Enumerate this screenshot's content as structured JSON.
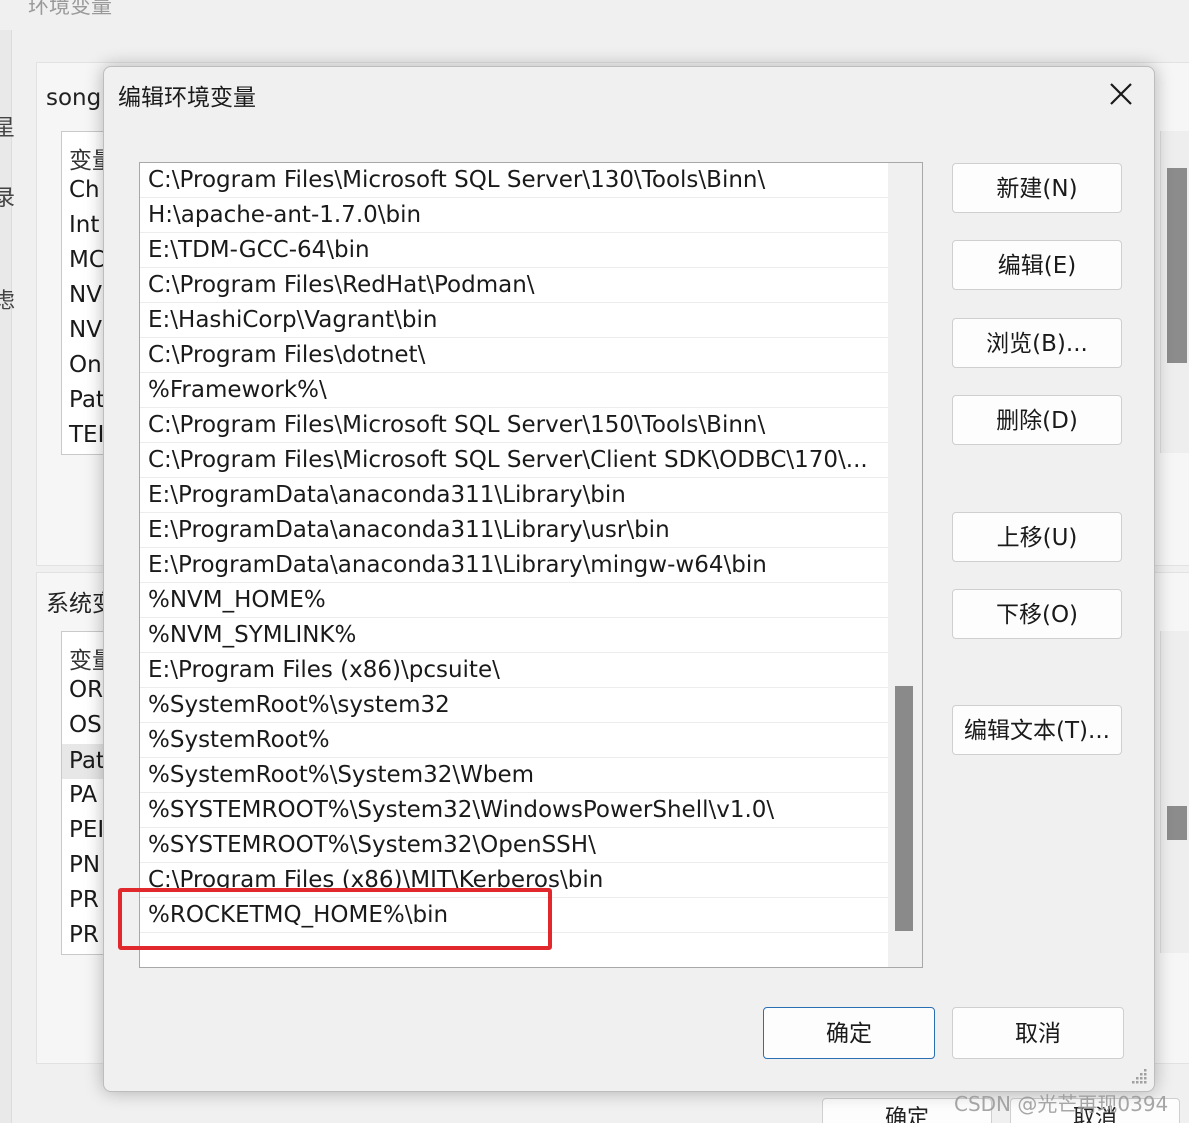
{
  "background": {
    "window_title": "环境变量",
    "left_strip_chars": [
      "星",
      "录",
      "虑"
    ],
    "user_group_label": "song",
    "user_list_items": [
      "变量",
      "Ch",
      "Int",
      "MC",
      "NV",
      "NV",
      "On",
      "Pat",
      "TEI"
    ],
    "system_group_label": "系统变",
    "system_list_items": [
      "变量",
      "OR",
      "OS",
      "Pat",
      "PA",
      "PEI",
      "PN",
      "PR",
      "PR"
    ],
    "bottom_buttons": [
      "确定",
      "取消"
    ]
  },
  "dialog": {
    "title": "编辑环境变量",
    "path_entries": [
      "C:\\Program Files\\Microsoft SQL Server\\130\\Tools\\Binn\\",
      "H:\\apache-ant-1.7.0\\bin",
      "E:\\TDM-GCC-64\\bin",
      "C:\\Program Files\\RedHat\\Podman\\",
      "E:\\HashiCorp\\Vagrant\\bin",
      "C:\\Program Files\\dotnet\\",
      "%Framework%\\",
      "C:\\Program Files\\Microsoft SQL Server\\150\\Tools\\Binn\\",
      "C:\\Program Files\\Microsoft SQL Server\\Client SDK\\ODBC\\170\\...",
      "E:\\ProgramData\\anaconda311\\Library\\bin",
      "E:\\ProgramData\\anaconda311\\Library\\usr\\bin",
      "E:\\ProgramData\\anaconda311\\Library\\mingw-w64\\bin",
      "%NVM_HOME%",
      "%NVM_SYMLINK%",
      "E:\\Program Files (x86)\\pcsuite\\",
      "%SystemRoot%\\system32",
      "%SystemRoot%",
      "%SystemRoot%\\System32\\Wbem",
      "%SYSTEMROOT%\\System32\\WindowsPowerShell\\v1.0\\",
      "%SYSTEMROOT%\\System32\\OpenSSH\\",
      "C:\\Program Files (x86)\\MIT\\Kerberos\\bin",
      "%ROCKETMQ_HOME%\\bin"
    ],
    "buttons": {
      "new": "新建(N)",
      "edit": "编辑(E)",
      "browse": "浏览(B)...",
      "delete": "删除(D)",
      "move_up": "上移(U)",
      "move_down": "下移(O)",
      "edit_text": "编辑文本(T)...",
      "ok": "确定",
      "cancel": "取消"
    },
    "highlight_color": "#e0282d"
  },
  "watermark": "CSDN @光芒再现0394"
}
